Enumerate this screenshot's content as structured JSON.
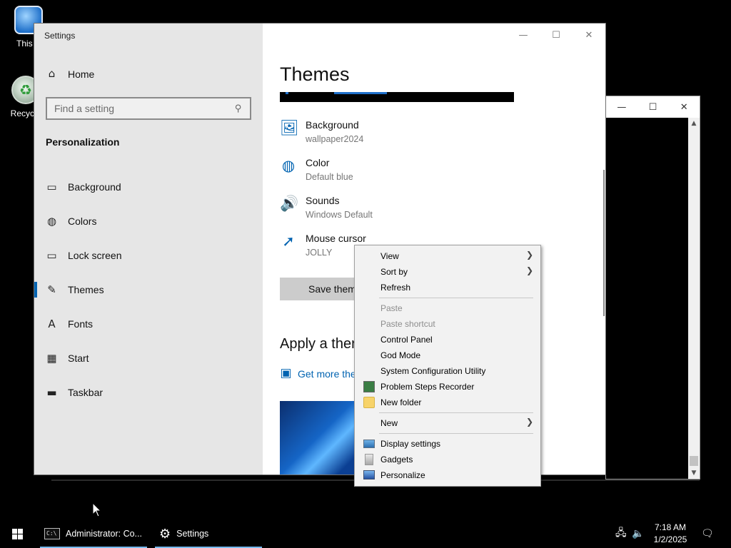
{
  "desktop": {
    "icons": [
      {
        "label": "This P",
        "icon": "this-pc-icon"
      },
      {
        "label": "Recycle",
        "icon": "recycle-bin-icon"
      }
    ]
  },
  "console_window": {
    "minimize": "—",
    "maximize": "☐",
    "close": "✕"
  },
  "settings": {
    "title": "Settings",
    "minimize": "—",
    "maximize": "☐",
    "close": "✕",
    "home_label": "Home",
    "search_placeholder": "Find a setting",
    "section": "Personalization",
    "nav": [
      {
        "label": "Background",
        "icon": "picture-icon",
        "glyph": "▭"
      },
      {
        "label": "Colors",
        "icon": "palette-icon",
        "glyph": "◍"
      },
      {
        "label": "Lock screen",
        "icon": "lock-screen-icon",
        "glyph": "▭"
      },
      {
        "label": "Themes",
        "icon": "themes-icon",
        "glyph": "✎",
        "active": true
      },
      {
        "label": "Fonts",
        "icon": "fonts-icon",
        "glyph": "A"
      },
      {
        "label": "Start",
        "icon": "start-icon",
        "glyph": "▦"
      },
      {
        "label": "Taskbar",
        "icon": "taskbar-icon",
        "glyph": "▬"
      }
    ],
    "page_title": "Themes",
    "properties": [
      {
        "name": "Background",
        "value": "wallpaper2024",
        "icon": "picture-icon"
      },
      {
        "name": "Color",
        "value": "Default blue",
        "icon": "palette-icon"
      },
      {
        "name": "Sounds",
        "value": "Windows Default",
        "icon": "speaker-icon"
      },
      {
        "name": "Mouse cursor",
        "value": "JOLLY",
        "icon": "cursor-icon"
      }
    ],
    "save_button": "Save them",
    "apply_heading": "Apply a ther",
    "get_more_link": "Get more the"
  },
  "context_menu": {
    "items": [
      {
        "label": "View",
        "submenu": true
      },
      {
        "label": "Sort by",
        "submenu": true
      },
      {
        "label": "Refresh"
      },
      {
        "separator": true
      },
      {
        "label": "Paste",
        "disabled": true
      },
      {
        "label": "Paste shortcut",
        "disabled": true
      },
      {
        "label": "Control Panel"
      },
      {
        "label": "God Mode"
      },
      {
        "label": "System Configuration Utility"
      },
      {
        "label": "Problem Steps Recorder",
        "icon": "problem-steps-recorder-icon"
      },
      {
        "label": "New folder",
        "icon": "folder-icon"
      },
      {
        "separator": true
      },
      {
        "label": "New",
        "submenu": true
      },
      {
        "separator": true
      },
      {
        "label": "Display settings",
        "icon": "display-icon"
      },
      {
        "label": "Gadgets",
        "icon": "gadgets-icon"
      },
      {
        "label": "Personalize",
        "icon": "personalize-icon"
      }
    ]
  },
  "taskbar": {
    "start_icon": "windows-logo-icon",
    "tasks": [
      {
        "label": "Administrator: Co...",
        "icon": "command-prompt-icon"
      },
      {
        "label": "Settings",
        "icon": "gear-icon"
      }
    ],
    "clock_time": "7:18 AM",
    "clock_date": "1/2/2025",
    "tray_icons": [
      "network-icon",
      "volume-icon",
      "notification-icon"
    ]
  }
}
